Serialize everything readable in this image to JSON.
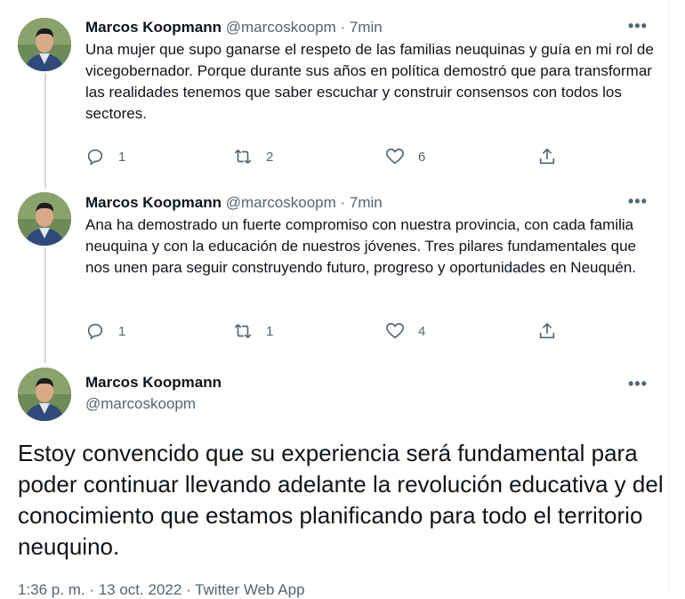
{
  "tweets": [
    {
      "name": "Marcos Koopmann",
      "meta": " @marcoskoopm · 7min",
      "text": "Una mujer que supo ganarse el respeto de las familias neuquinas y guía en mi rol de vicegobernador. Porque durante sus años en política demostró que para transformar las realidades tenemos que saber escuchar y construir consensos con todos los sectores.",
      "replies": "1",
      "retweets": "2",
      "likes": "6"
    },
    {
      "name": "Marcos Koopmann",
      "meta": " @marcoskoopm · 7min",
      "text": "Ana ha demostrado un fuerte compromiso con nuestra provincia, con cada familia neuquina y con la educación de nuestros jóvenes. Tres pilares fundamentales que nos unen para seguir construyendo futuro, progreso y oportunidades en Neuquén.",
      "replies": "1",
      "retweets": "1",
      "likes": "4"
    }
  ],
  "main": {
    "name": "Marcos Koopmann",
    "handle": "@marcoskoopm",
    "text": "Estoy convencido que su experiencia será fundamental para poder continuar llevando adelante la revolución educativa y del conocimiento que estamos planificando para todo el territorio neuquino.",
    "footer": "1:36 p. m. · 13 oct. 2022 · Twitter Web App"
  },
  "more_label": "•••"
}
